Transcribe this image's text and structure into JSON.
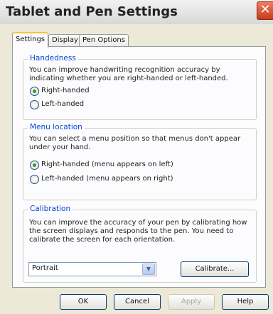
{
  "window": {
    "title": "Tablet and Pen Settings",
    "close_glyph": "✕"
  },
  "tabs": [
    {
      "label": "Settings",
      "active": true
    },
    {
      "label": "Display",
      "active": false
    },
    {
      "label": "Pen Options",
      "active": false
    }
  ],
  "handedness": {
    "legend": "Handedness",
    "description": "You can improve handwriting recognition accuracy by indicating whether you are right-handed or left-handed.",
    "options": [
      {
        "label": "Right-handed",
        "checked": true
      },
      {
        "label": "Left-handed",
        "checked": false
      }
    ]
  },
  "menu_location": {
    "legend": "Menu location",
    "description": "You can select a menu position so that menus don't appear under your hand.",
    "options": [
      {
        "label": "Right-handed (menu appears on left)",
        "checked": true
      },
      {
        "label": "Left-handed (menu appears on right)",
        "checked": false
      }
    ]
  },
  "calibration": {
    "legend": "Calibration",
    "description": "You can improve the accuracy of your pen by calibrating how the screen displays and responds to the pen. You need to calibrate the screen for each orientation.",
    "orientation_value": "Portrait",
    "calibrate_label": "Calibrate..."
  },
  "footer": {
    "ok": "OK",
    "cancel": "Cancel",
    "apply": "Apply",
    "help": "Help"
  },
  "colors": {
    "accent": "#0046d5",
    "window_bg": "#ece9d8",
    "close_button": "#d9532c"
  }
}
